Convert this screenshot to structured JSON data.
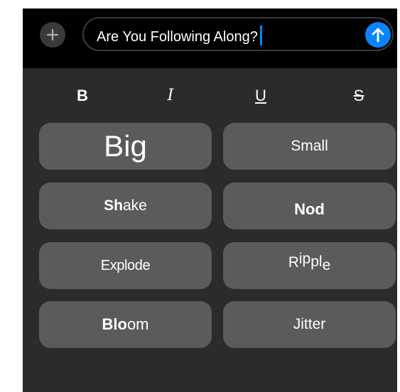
{
  "input_bar": {
    "plus_icon": "plus-icon",
    "message_value": "Are You Following Along?",
    "send_icon": "arrow-up-icon",
    "send_color": "#0a84ff"
  },
  "formatting": {
    "bold": "B",
    "italic": "I",
    "underline": "U",
    "strikethrough": "S"
  },
  "effects": {
    "big": "Big",
    "small": "Small",
    "shake": {
      "strong": "Sh",
      "rest": "ake"
    },
    "nod": "Nod",
    "explode": "Explode",
    "ripple": {
      "p1": "R",
      "p2": "i",
      "p3": "p",
      "p4": "p",
      "p5": "l",
      "p6": "e"
    },
    "bloom": {
      "strong": "Blo",
      "rest": "om"
    },
    "jitter": "Jitter"
  },
  "colors": {
    "panel_background": "#2b2b2d",
    "effect_button": "#5b5b5e",
    "input_background": "#000000",
    "accent": "#0a84ff"
  }
}
